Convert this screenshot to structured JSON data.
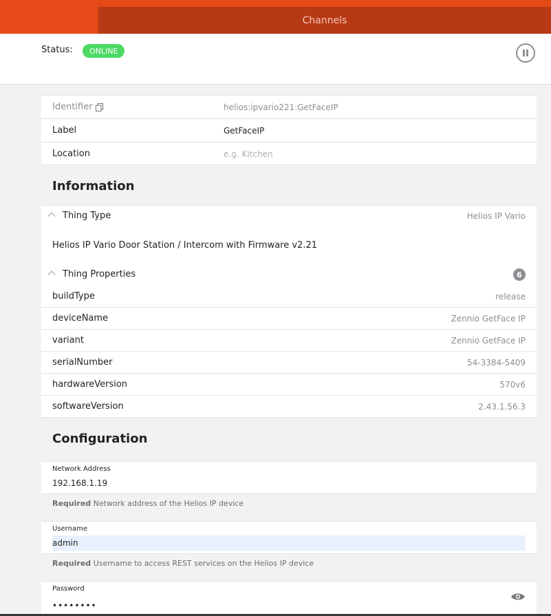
{
  "header": {
    "tab_channels": "Channels"
  },
  "status": {
    "label": "Status:",
    "badge": "ONLINE",
    "badge_color": "#4cd964"
  },
  "thing": {
    "identifier_label": "Identifier",
    "identifier_value": "helios:ipvario221:GetFaceIP",
    "label_label": "Label",
    "label_value": "GetFaceIP",
    "location_label": "Location",
    "location_placeholder": "e.g. Kitchen"
  },
  "information": {
    "title": "Information",
    "thing_type_label": "Thing Type",
    "thing_type_value": "Helios IP Vario",
    "description": "Helios IP Vario Door Station / Intercom with Firmware v2.21",
    "properties_label": "Thing Properties",
    "properties_count": "6",
    "properties": [
      {
        "key": "buildType",
        "value": "release"
      },
      {
        "key": "deviceName",
        "value": "Zennio GetFace IP"
      },
      {
        "key": "variant",
        "value": "Zennio GetFace IP"
      },
      {
        "key": "serialNumber",
        "value": "54-3384-5409"
      },
      {
        "key": "hardwareVersion",
        "value": "570v6"
      },
      {
        "key": "softwareVersion",
        "value": "2.43.1.56.3"
      }
    ]
  },
  "configuration": {
    "title": "Configuration",
    "network_label": "Network Address",
    "network_value": "192.168.1.19",
    "network_hint_req": "Required",
    "network_hint": "Network address of the Helios IP device",
    "username_label": "Username",
    "username_value": "admin",
    "username_hint_req": "Required",
    "username_hint": "Username to access REST services on the Helios IP device",
    "password_label": "Password",
    "password_value": "••••••••"
  },
  "colors": {
    "accent": "#e64a19",
    "accent_dark": "#b83915"
  }
}
